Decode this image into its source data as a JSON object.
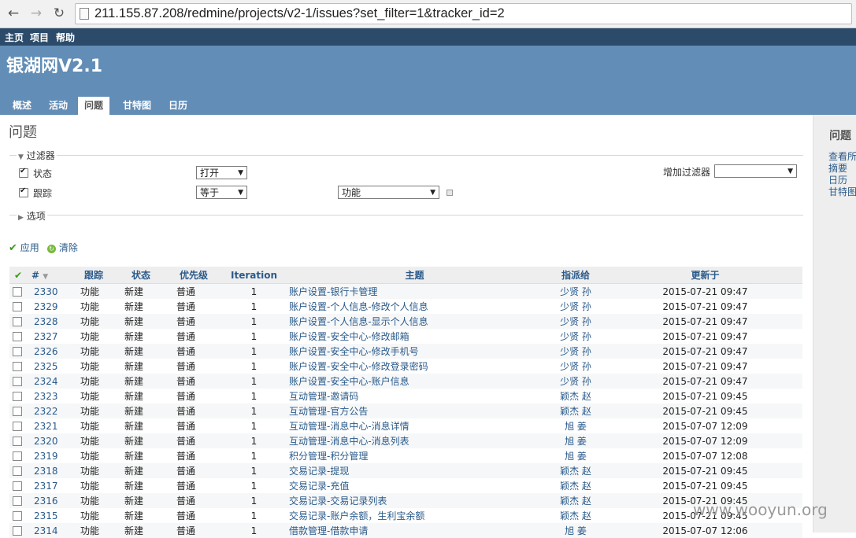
{
  "browser": {
    "back_icon": "arrow-left-icon",
    "forward_icon": "arrow-right-icon",
    "reload_icon": "reload-icon",
    "url": "211.155.87.208/redmine/projects/v2-1/issues?set_filter=1&tracker_id=2"
  },
  "top_menu": {
    "home": "主页",
    "projects": "项目",
    "help": "帮助"
  },
  "project_title": "银湖网V2.1",
  "tabs": [
    "概述",
    "活动",
    "问题",
    "甘特图",
    "日历"
  ],
  "selected_tab": "问题",
  "page_title": "问题",
  "filters": {
    "legend": "过滤器",
    "status_label": "状态",
    "status_op": "打开",
    "tracker_label": "跟踪",
    "tracker_op": "等于",
    "tracker_value": "功能",
    "add_filter_label": "增加过滤器",
    "add_filter_value": ""
  },
  "options": {
    "legend": "选项"
  },
  "actions": {
    "apply": "应用",
    "clear": "清除"
  },
  "table": {
    "headers": {
      "id": "#",
      "tracker": "跟踪",
      "status": "状态",
      "priority": "优先级",
      "iteration": "Iteration",
      "subject": "主题",
      "assignee": "指派给",
      "updated": "更新于"
    },
    "rows": [
      {
        "id": "2330",
        "tracker": "功能",
        "status": "新建",
        "priority": "普通",
        "iteration": "1",
        "subject": "账户设置-银行卡管理",
        "assignee": "少贤 孙",
        "updated": "2015-07-21 09:47"
      },
      {
        "id": "2329",
        "tracker": "功能",
        "status": "新建",
        "priority": "普通",
        "iteration": "1",
        "subject": "账户设置-个人信息-修改个人信息",
        "assignee": "少贤 孙",
        "updated": "2015-07-21 09:47"
      },
      {
        "id": "2328",
        "tracker": "功能",
        "status": "新建",
        "priority": "普通",
        "iteration": "1",
        "subject": "账户设置-个人信息-显示个人信息",
        "assignee": "少贤 孙",
        "updated": "2015-07-21 09:47"
      },
      {
        "id": "2327",
        "tracker": "功能",
        "status": "新建",
        "priority": "普通",
        "iteration": "1",
        "subject": "账户设置-安全中心-修改邮箱",
        "assignee": "少贤 孙",
        "updated": "2015-07-21 09:47"
      },
      {
        "id": "2326",
        "tracker": "功能",
        "status": "新建",
        "priority": "普通",
        "iteration": "1",
        "subject": "账户设置-安全中心-修改手机号",
        "assignee": "少贤 孙",
        "updated": "2015-07-21 09:47"
      },
      {
        "id": "2325",
        "tracker": "功能",
        "status": "新建",
        "priority": "普通",
        "iteration": "1",
        "subject": "账户设置-安全中心-修改登录密码",
        "assignee": "少贤 孙",
        "updated": "2015-07-21 09:47"
      },
      {
        "id": "2324",
        "tracker": "功能",
        "status": "新建",
        "priority": "普通",
        "iteration": "1",
        "subject": "账户设置-安全中心-账户信息",
        "assignee": "少贤 孙",
        "updated": "2015-07-21 09:47"
      },
      {
        "id": "2323",
        "tracker": "功能",
        "status": "新建",
        "priority": "普通",
        "iteration": "1",
        "subject": "互动管理-邀请码",
        "assignee": "颖杰 赵",
        "updated": "2015-07-21 09:45"
      },
      {
        "id": "2322",
        "tracker": "功能",
        "status": "新建",
        "priority": "普通",
        "iteration": "1",
        "subject": "互动管理-官方公告",
        "assignee": "颖杰 赵",
        "updated": "2015-07-21 09:45"
      },
      {
        "id": "2321",
        "tracker": "功能",
        "status": "新建",
        "priority": "普通",
        "iteration": "1",
        "subject": "互动管理-消息中心-消息详情",
        "assignee": "旭 姜",
        "updated": "2015-07-07 12:09"
      },
      {
        "id": "2320",
        "tracker": "功能",
        "status": "新建",
        "priority": "普通",
        "iteration": "1",
        "subject": "互动管理-消息中心-消息列表",
        "assignee": "旭 姜",
        "updated": "2015-07-07 12:09"
      },
      {
        "id": "2319",
        "tracker": "功能",
        "status": "新建",
        "priority": "普通",
        "iteration": "1",
        "subject": "积分管理-积分管理",
        "assignee": "旭 姜",
        "updated": "2015-07-07 12:08"
      },
      {
        "id": "2318",
        "tracker": "功能",
        "status": "新建",
        "priority": "普通",
        "iteration": "1",
        "subject": "交易记录-提现",
        "assignee": "颖杰 赵",
        "updated": "2015-07-21 09:45"
      },
      {
        "id": "2317",
        "tracker": "功能",
        "status": "新建",
        "priority": "普通",
        "iteration": "1",
        "subject": "交易记录-充值",
        "assignee": "颖杰 赵",
        "updated": "2015-07-21 09:45"
      },
      {
        "id": "2316",
        "tracker": "功能",
        "status": "新建",
        "priority": "普通",
        "iteration": "1",
        "subject": "交易记录-交易记录列表",
        "assignee": "颖杰 赵",
        "updated": "2015-07-21 09:45"
      },
      {
        "id": "2315",
        "tracker": "功能",
        "status": "新建",
        "priority": "普通",
        "iteration": "1",
        "subject": "交易记录-账户余额，生利宝余额",
        "assignee": "颖杰 赵",
        "updated": "2015-07-21 09:45"
      },
      {
        "id": "2314",
        "tracker": "功能",
        "status": "新建",
        "priority": "普通",
        "iteration": "1",
        "subject": "借款管理-借款申请",
        "assignee": "旭 姜",
        "updated": "2015-07-07 12:06"
      }
    ]
  },
  "sidebar": {
    "title": "问题",
    "links": [
      "查看所",
      "摘要",
      "日历",
      "甘特图"
    ]
  },
  "watermark": "www.wooyun.org"
}
